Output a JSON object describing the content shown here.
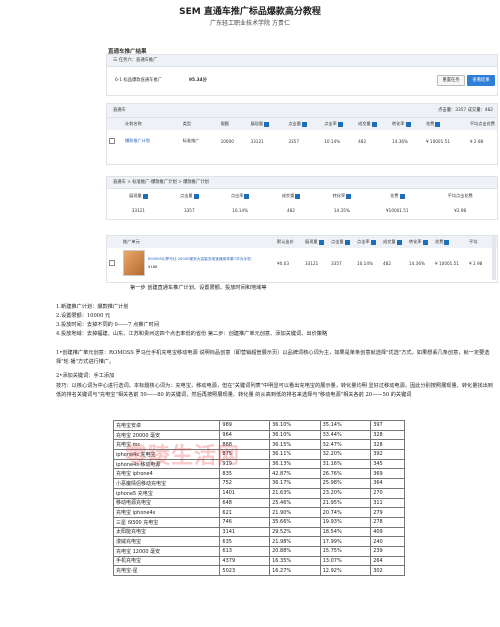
{
  "doc": {
    "title": "SEM 直通车推广标品爆款高分教程",
    "author": "广东轻工职业技术学院  方贵仁",
    "section_title": "直通车推广结果"
  },
  "task_panel": {
    "breadcrumb": "任务六：直通车推广",
    "item_label": "6-1 标品爆款直通车推广",
    "score": "95.34分",
    "btn_reset": "重置任务",
    "btn_result": "查看结果"
  },
  "campaign": {
    "header_label": "直通车",
    "stats": "点击量：3357     成交量：482",
    "columns": [
      "计划名称",
      "类型",
      "限额",
      "展现量",
      "点击量",
      "点击率",
      "成交量",
      "转化率",
      "花费",
      "平均点击花费"
    ],
    "row": [
      "爆款推广计划",
      "标准推广",
      "10000",
      "33121",
      "3357",
      "10.14%",
      "482",
      "14.36%",
      "¥ 10001.51",
      "¥ 2.98"
    ]
  },
  "summary": {
    "breadcrumb": "直通车 > 标准推广-爆款推广计划 > 爆款推广计划",
    "columns": [
      "展现量",
      "点击量",
      "点击率",
      "成交量",
      "转化率",
      "花费",
      "平均点击花费"
    ],
    "row": [
      "33121",
      "3357",
      "10.14%",
      "482",
      "14.35%",
      "¥10001.51",
      "¥2.98"
    ]
  },
  "unit": {
    "columns": [
      "推广单元",
      "默认出价",
      "展现量",
      "点击量",
      "点击率",
      "成交量",
      "转化率",
      "花费",
      "平均"
    ],
    "product_name": "ROMOSS/罗马仕 20000毫安大容量充电宝通用苹果7华为手机",
    "product_price": "¥188",
    "row": [
      "¥0.03",
      "33121",
      "3357",
      "10.14%",
      "482",
      "14.36%",
      "¥ 10001.51",
      "¥ 2.98"
    ]
  },
  "caption": "第一步  创建直通车推广计划、设置限额、投放时间和地域等",
  "steps": [
    "1.新建推广计划：爆款推广计划",
    "2.设置限额：10000 元",
    "3.投放时间：去掉不同的 0——7 点推广时间",
    "4.投放地域：去掉福建、山东、江苏和贵州这四个点击率低的省份  第二步：创建推广单元创意、添加关键词、出价策略"
  ],
  "para1": "1•创建推广单元创意：ROMOSS 罗马仕手机充电宝移动电源  说明标品创意（即营销超管展示页）以品牌词核心词为主，如果是单条创意就选择\"优选\"方式，如果想丢几条创意，就一定要选择\"轮  播\"方式进行推广。",
  "para2_title": "2•添加关键词：手工添加",
  "para2": "技巧：以核心词为中心进行选词，本标题核心词为：充电宝，移动电源，但在\"关键词列表\"中明显可以看出充电宝的展示量，转化量均明  显好过移动电源，因此分别按照展现量、转化量找出到低的排名关键词与\"充电宝\"相关各前 50——80 的关键词，然后再按照展现量、转化量  的从高到低的排名来选择与\"移动电源\"相关各前 20——50 的关键词",
  "keywords": [
    [
      "充电宝安卓",
      "989",
      "36.10%",
      "35.14%",
      "397"
    ],
    [
      "充电宝 20000 毫安",
      "964",
      "36.10%",
      "33.44%",
      "328"
    ],
    [
      "充电宝 mc",
      "868",
      "36.15%",
      "32.47%",
      "328"
    ],
    [
      "iphone4s 充电宝",
      "875",
      "36.11%",
      "32.20%",
      "392"
    ],
    [
      "iphone4s 移动电源",
      "919",
      "36.13%",
      "31.16%",
      "345"
    ],
    [
      "充电宝 iphone4",
      "835",
      "42.87%",
      "26.76%",
      "369"
    ],
    [
      "小恶魔情侣移动充电宝",
      "752",
      "36.17%",
      "25.98%",
      "364"
    ],
    [
      "iphone5 充电宝",
      "1401",
      "21.63%",
      "23.20%",
      "270"
    ],
    [
      "移动电源充电宝",
      "648",
      "25.46%",
      "21.95%",
      "311"
    ],
    [
      "充电宝 iphone4s",
      "621",
      "21.90%",
      "20.74%",
      "279"
    ],
    [
      "三星 i9300 充电宝",
      "746",
      "35.66%",
      "19.93%",
      "278"
    ],
    [
      "太阳能充电宝",
      "3141",
      "29.52%",
      "18.54%",
      "409"
    ],
    [
      "漫威充电宝",
      "635",
      "21.98%",
      "17.99%",
      "240"
    ],
    [
      "充电宝 12000 毫安",
      "613",
      "20.88%",
      "15.75%",
      "239"
    ],
    [
      "手机充电宝",
      "4379",
      "16.35%",
      "13.07%",
      "264"
    ],
    [
      "充电宝-星",
      "5023",
      "16.27%",
      "12.92%",
      "302"
    ]
  ],
  "watermark": "零陵生活网",
  "colors": {
    "accent": "#2f7fd8",
    "panel_bar": "#eef1f5",
    "link": "#2562b8",
    "watermark": "#e13c3c"
  }
}
